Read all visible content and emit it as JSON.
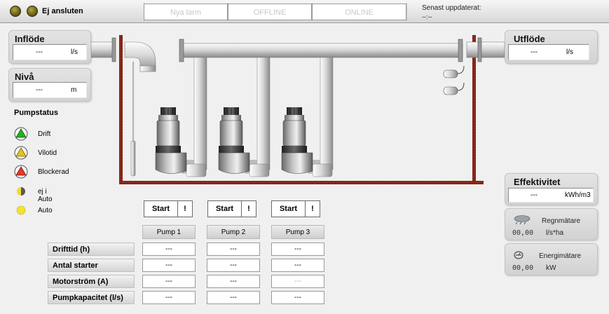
{
  "topbar": {
    "status": "Ej ansluten",
    "alarms": "Nya larm",
    "offline": "OFFLINE",
    "online": "ONLINE",
    "last_updated_label": "Senast uppdaterat:",
    "last_updated_value": "--:--"
  },
  "inflow": {
    "title": "Inflöde",
    "value": "---",
    "unit": "l/s"
  },
  "level": {
    "title": "Nivå",
    "value": "---",
    "unit": "m"
  },
  "outflow": {
    "title": "Utflöde",
    "value": "---",
    "unit": "l/s"
  },
  "efficiency": {
    "title": "Effektivitet",
    "value": "---",
    "unit": "kWh/m3"
  },
  "rain_meter": {
    "label": "Regnmätare",
    "value": "00,00",
    "unit": "l/s*ha"
  },
  "energy_meter": {
    "label": "Energimätare",
    "value": "00,00",
    "unit": "kW"
  },
  "pump_status": {
    "title": "Pumpstatus",
    "items": [
      {
        "label": "Drift",
        "color": "#20b020"
      },
      {
        "label": "Vilotid",
        "color": "#e0c020"
      },
      {
        "label": "Blockerad",
        "color": "#e03a2a"
      },
      {
        "label": "ej i Auto",
        "color": "#e8d020"
      },
      {
        "label": "Auto",
        "color": "#f0e040"
      }
    ]
  },
  "start_label": "Start",
  "alert_label": "!",
  "pumps": [
    {
      "name": "Pump 1"
    },
    {
      "name": "Pump 2"
    },
    {
      "name": "Pump 3"
    }
  ],
  "table": {
    "rows": [
      {
        "label": "Drifttid (h)",
        "values": [
          "---",
          "---",
          "---"
        ]
      },
      {
        "label": "Antal starter",
        "values": [
          "---",
          "---",
          "---"
        ]
      },
      {
        "label": "Motorström (A)",
        "values": [
          "---",
          "---",
          "---"
        ]
      },
      {
        "label": "Pumpkapacitet (l/s)",
        "values": [
          "---",
          "---",
          "---"
        ]
      }
    ]
  }
}
